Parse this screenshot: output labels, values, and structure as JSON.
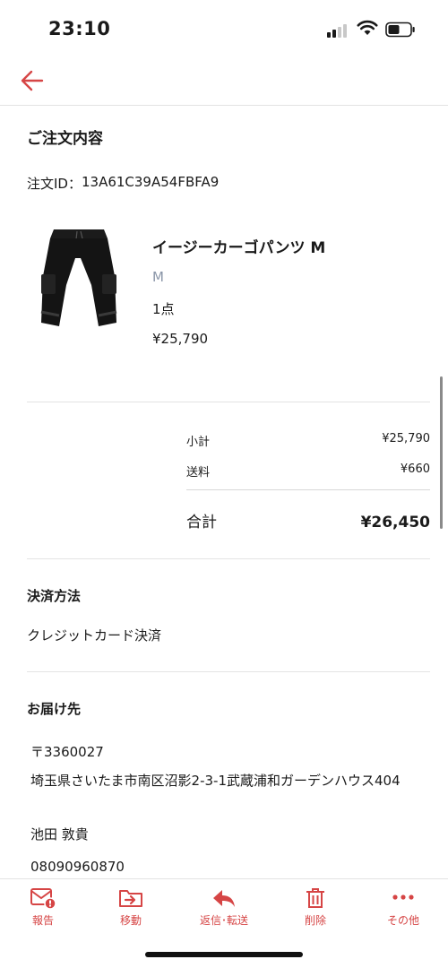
{
  "status_bar": {
    "time": "23:10"
  },
  "accent_color": "#d64545",
  "header": {
    "back_icon": "arrow-left-icon"
  },
  "order": {
    "section_title": "ご注文内容",
    "order_id_label": "注文ID：",
    "order_id_value": "13A61C39A54FBFA9",
    "product": {
      "name": "イージーカーゴパンツ M",
      "size": "M",
      "quantity": "1点",
      "price": "¥25,790",
      "image_icon": "black-cargo-pants-image"
    },
    "summary": {
      "subtotal_label": "小計",
      "subtotal_value": "¥25,790",
      "shipping_label": "送料",
      "shipping_value": "¥660",
      "total_label": "合計",
      "total_value": "¥26,450"
    }
  },
  "payment": {
    "title": "決済方法",
    "method": "クレジットカード決済"
  },
  "delivery": {
    "title": "お届け先",
    "postal": "〒3360027",
    "address": "埼玉県さいたま市南区沼影2-3-1武蔵浦和ガーデンハウス404",
    "name": "池田 敦貴",
    "phone": "08090960870"
  },
  "toolbar": {
    "report_label": "報告",
    "move_label": "移動",
    "reply_label": "返信･転送",
    "delete_label": "削除",
    "more_label": "その他"
  }
}
